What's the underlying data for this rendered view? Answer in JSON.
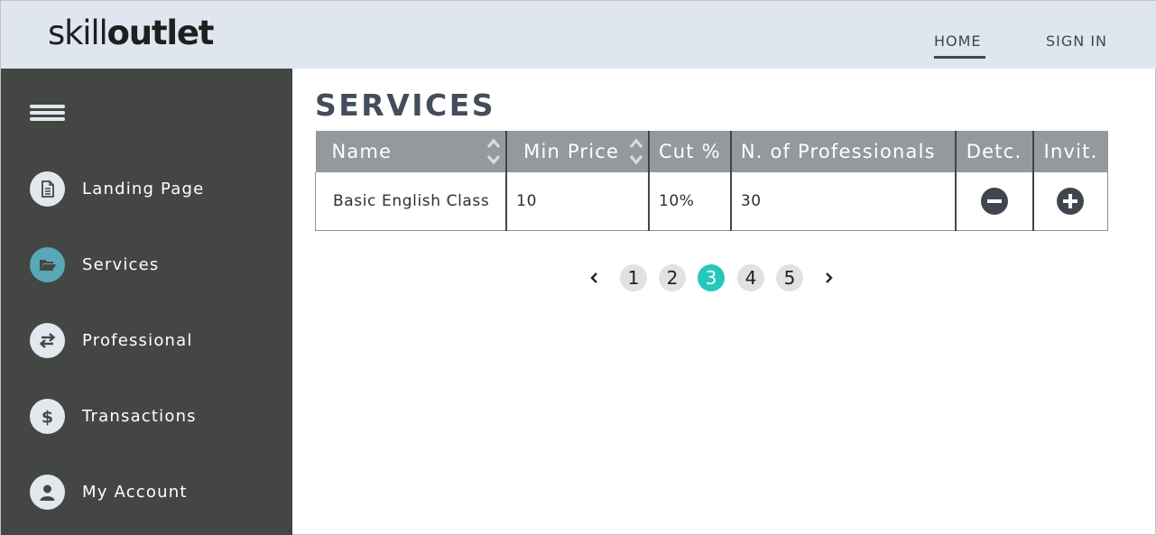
{
  "brand": {
    "part1": "skill",
    "part2": "outlet"
  },
  "topnav": {
    "home": "HOME",
    "sign_in": "SIGN IN"
  },
  "sidebar": {
    "items": [
      {
        "label": "Landing Page",
        "icon": "document-icon",
        "active": false
      },
      {
        "label": "Services",
        "icon": "folder-open-icon",
        "active": true
      },
      {
        "label": "Professional",
        "icon": "swap-arrows-icon",
        "active": false
      },
      {
        "label": "Transactions",
        "icon": "dollar-icon",
        "active": false
      },
      {
        "label": "My Account",
        "icon": "user-icon",
        "active": false
      }
    ]
  },
  "page": {
    "title": "SERVICES"
  },
  "table": {
    "headers": [
      "Name",
      "Min Price",
      "Cut %",
      "N. of Professionals",
      "Detc.",
      "Invit."
    ],
    "rows": [
      {
        "name": "Basic English Class",
        "min_price": "10",
        "cut": "10%",
        "professionals": "30"
      }
    ]
  },
  "pagination": {
    "prev": "‹",
    "next": "›",
    "pages": [
      "1",
      "2",
      "3",
      "4",
      "5"
    ],
    "current": "3"
  },
  "colors": {
    "topbar": "#dfe6f0",
    "sidebar": "#444644",
    "accent": "#24c7bb",
    "active_icon": "#5aa7b8",
    "table_header": "#96999c",
    "title": "#434d5b"
  }
}
